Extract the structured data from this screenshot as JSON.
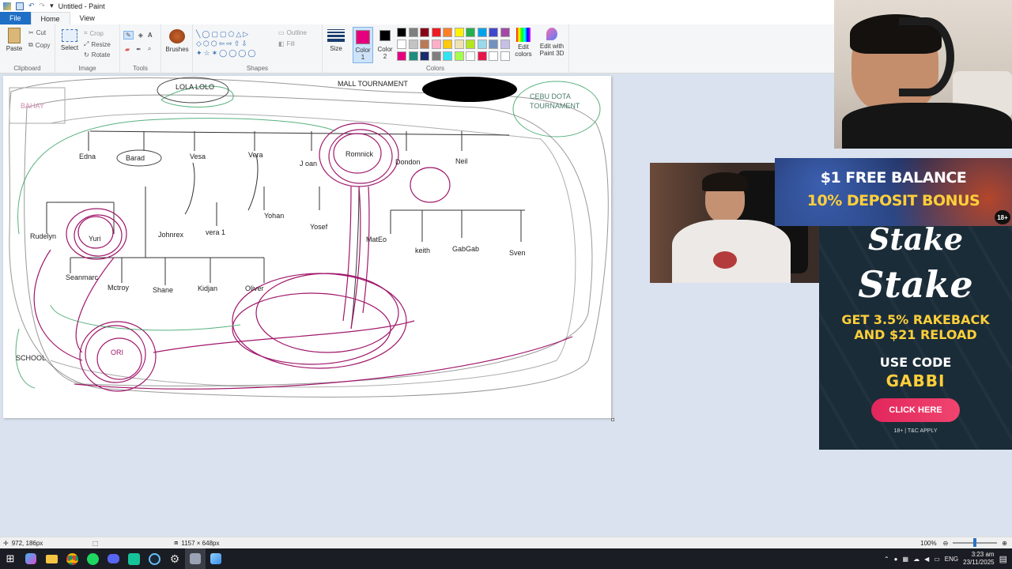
{
  "window": {
    "title": "Untitled - Paint"
  },
  "tabs": [
    {
      "label": "File"
    },
    {
      "label": "Home"
    },
    {
      "label": "View"
    }
  ],
  "ribbon": {
    "clipboard": {
      "paste": "Paste",
      "cut": "Cut",
      "copy": "Copy",
      "group": "Clipboard"
    },
    "image": {
      "select": "Select",
      "crop": "Crop",
      "resize": "Resize",
      "rotate": "Rotate",
      "group": "Image"
    },
    "tools": {
      "group": "Tools"
    },
    "brushes": {
      "label": "Brushes"
    },
    "shapes": {
      "outline": "Outline",
      "fill": "Fill",
      "group": "Shapes"
    },
    "size": {
      "label": "Size"
    },
    "color1": {
      "label": "Color 1",
      "value": "#e6007e"
    },
    "color2": {
      "label": "Color 2",
      "value": "#000000"
    },
    "colors_group": "Colors",
    "edit_colors": "Edit colors",
    "edit_paint3d": "Edit with Paint 3D",
    "palette": [
      "#000000",
      "#7f7f7f",
      "#880015",
      "#ed1c24",
      "#ff7f27",
      "#fff200",
      "#22b14c",
      "#00a2e8",
      "#3f48cc",
      "#a349a4",
      "#ffffff",
      "#c3c3c3",
      "#b97a57",
      "#ffaec9",
      "#ffc90e",
      "#efe4b0",
      "#b5e61d",
      "#99d9ea",
      "#7092be",
      "#c8bfe7",
      "#e6007e",
      "#1e8c7e",
      "#1a2a6c",
      "#7f7f7f",
      "#33e3f2",
      "#a6ff4d",
      "#ffffff",
      "#e8154a",
      "#ffffff",
      "#ffffff"
    ]
  },
  "canvas": {
    "labels": {
      "bahay": "BAHAY",
      "lola": "LOLA LOLO",
      "mall": "MALL TOURNAMENT",
      "cebu1": "CEBU DOTA",
      "cebu2": "TOURNAMENT",
      "edna": "Edna",
      "barad": "Barad",
      "vesa": "Vesa",
      "vera": "Vera",
      "joan": "J oan",
      "romnick": "Romnick",
      "dondon": "Dondon",
      "neil": "Neil",
      "rudelyn": "Rudelyn",
      "yuri": "Yuri",
      "johnrex": "Johnrex",
      "vera1": "vera 1",
      "yohan": "Yohan",
      "yosef": "Yosef",
      "mateo": "MatEo",
      "keith": "keith",
      "gabgab": "GabGab",
      "sven": "Sven",
      "seanmarc": "Seanmarc",
      "mctroy": "Mctroy",
      "shane": "Shane",
      "kidjan": "Kidjan",
      "oliver": "Oliver",
      "school": "SCHOOL",
      "ori": "ORI"
    }
  },
  "status": {
    "cursor": "972, 186px",
    "size": "1157 × 648px",
    "zoom": "100%"
  },
  "taskbar": {
    "lang": "ENG",
    "time": "3:23 am",
    "date": "23/11/2025"
  },
  "ad": {
    "top_line1": "$1 FREE BALANCE",
    "top_line2": "10% DEPOSIT BONUS",
    "age_badge": "18+",
    "brand": "Stake",
    "brand2": "Stake",
    "promo1": "GET 3.5% RAKEBACK",
    "promo2": "AND $21 RELOAD",
    "use_code": "USE CODE",
    "code": "GABBI",
    "cta": "CLICK HERE",
    "disclaimer": "18+ | T&C APPLY"
  }
}
